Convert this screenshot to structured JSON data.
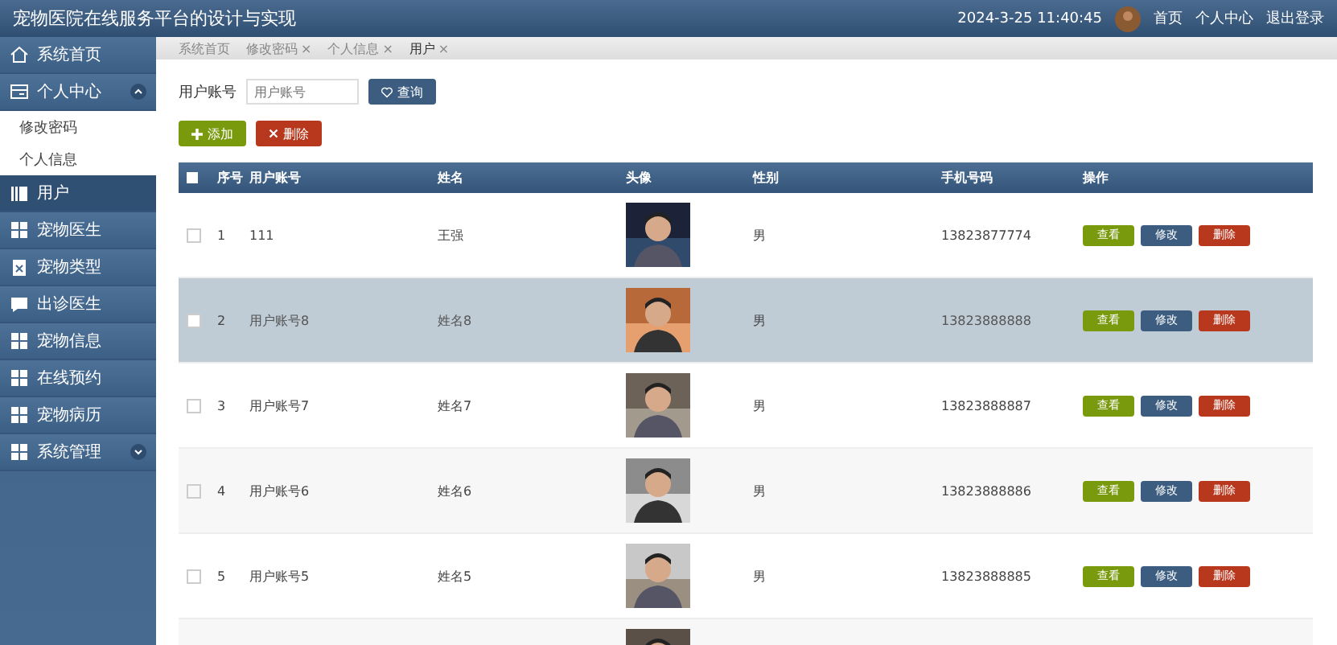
{
  "header": {
    "title": "宠物医院在线服务平台的设计与实现",
    "datetime": "2024-3-25 11:40:45",
    "links": [
      "首页",
      "个人中心",
      "退出登录"
    ]
  },
  "sidebar": {
    "items": [
      {
        "label": "系统首页",
        "kind": "home",
        "selected": false
      },
      {
        "label": "个人中心",
        "kind": "card",
        "selected": false,
        "expanded": true,
        "children": [
          {
            "label": "修改密码"
          },
          {
            "label": "个人信息"
          }
        ]
      },
      {
        "label": "用户",
        "kind": "book",
        "selected": true
      },
      {
        "label": "宠物医生",
        "kind": "grid",
        "selected": false
      },
      {
        "label": "宠物类型",
        "kind": "clip",
        "selected": false
      },
      {
        "label": "出诊医生",
        "kind": "chat",
        "selected": false
      },
      {
        "label": "宠物信息",
        "kind": "grid",
        "selected": false
      },
      {
        "label": "在线预约",
        "kind": "grid",
        "selected": false
      },
      {
        "label": "宠物病历",
        "kind": "grid",
        "selected": false
      },
      {
        "label": "系统管理",
        "kind": "grid",
        "selected": false,
        "expanded": false
      }
    ]
  },
  "breadcrumbs": [
    {
      "label": "系统首页"
    },
    {
      "label": "修改密码",
      "close": "×"
    },
    {
      "label": "个人信息",
      "close": "×"
    },
    {
      "label": "用户",
      "close": "×"
    }
  ],
  "search": {
    "label": "用户账号",
    "placeholder": "用户账号",
    "button": "查询"
  },
  "actions": {
    "add": "添加",
    "delete": "删除"
  },
  "table": {
    "select_all_checked": false,
    "columns": [
      "序号",
      "用户账号",
      "姓名",
      "头像",
      "性别",
      "手机号码",
      "操作"
    ],
    "rows": [
      {
        "checked": false,
        "index": "1",
        "account": "111",
        "name": "王强",
        "gender": "男",
        "phone": "13823877774",
        "highlighted": false,
        "buttons": [
          "查看",
          "修改",
          "删除"
        ]
      },
      {
        "checked": false,
        "index": "2",
        "account": "用户账号8",
        "name": "姓名8",
        "gender": "男",
        "phone": "13823888888",
        "highlighted": true,
        "buttons": [
          "查看",
          "修改",
          "删除"
        ]
      },
      {
        "checked": false,
        "index": "3",
        "account": "用户账号7",
        "name": "姓名7",
        "gender": "男",
        "phone": "13823888887",
        "highlighted": false,
        "buttons": [
          "查看",
          "修改",
          "删除"
        ]
      },
      {
        "checked": false,
        "index": "4",
        "account": "用户账号6",
        "name": "姓名6",
        "gender": "男",
        "phone": "13823888886",
        "highlighted": false,
        "buttons": [
          "查看",
          "修改",
          "删除"
        ]
      },
      {
        "checked": false,
        "index": "5",
        "account": "用户账号5",
        "name": "姓名5",
        "gender": "男",
        "phone": "13823888885",
        "highlighted": false,
        "buttons": [
          "查看",
          "修改",
          "删除"
        ]
      }
    ]
  }
}
